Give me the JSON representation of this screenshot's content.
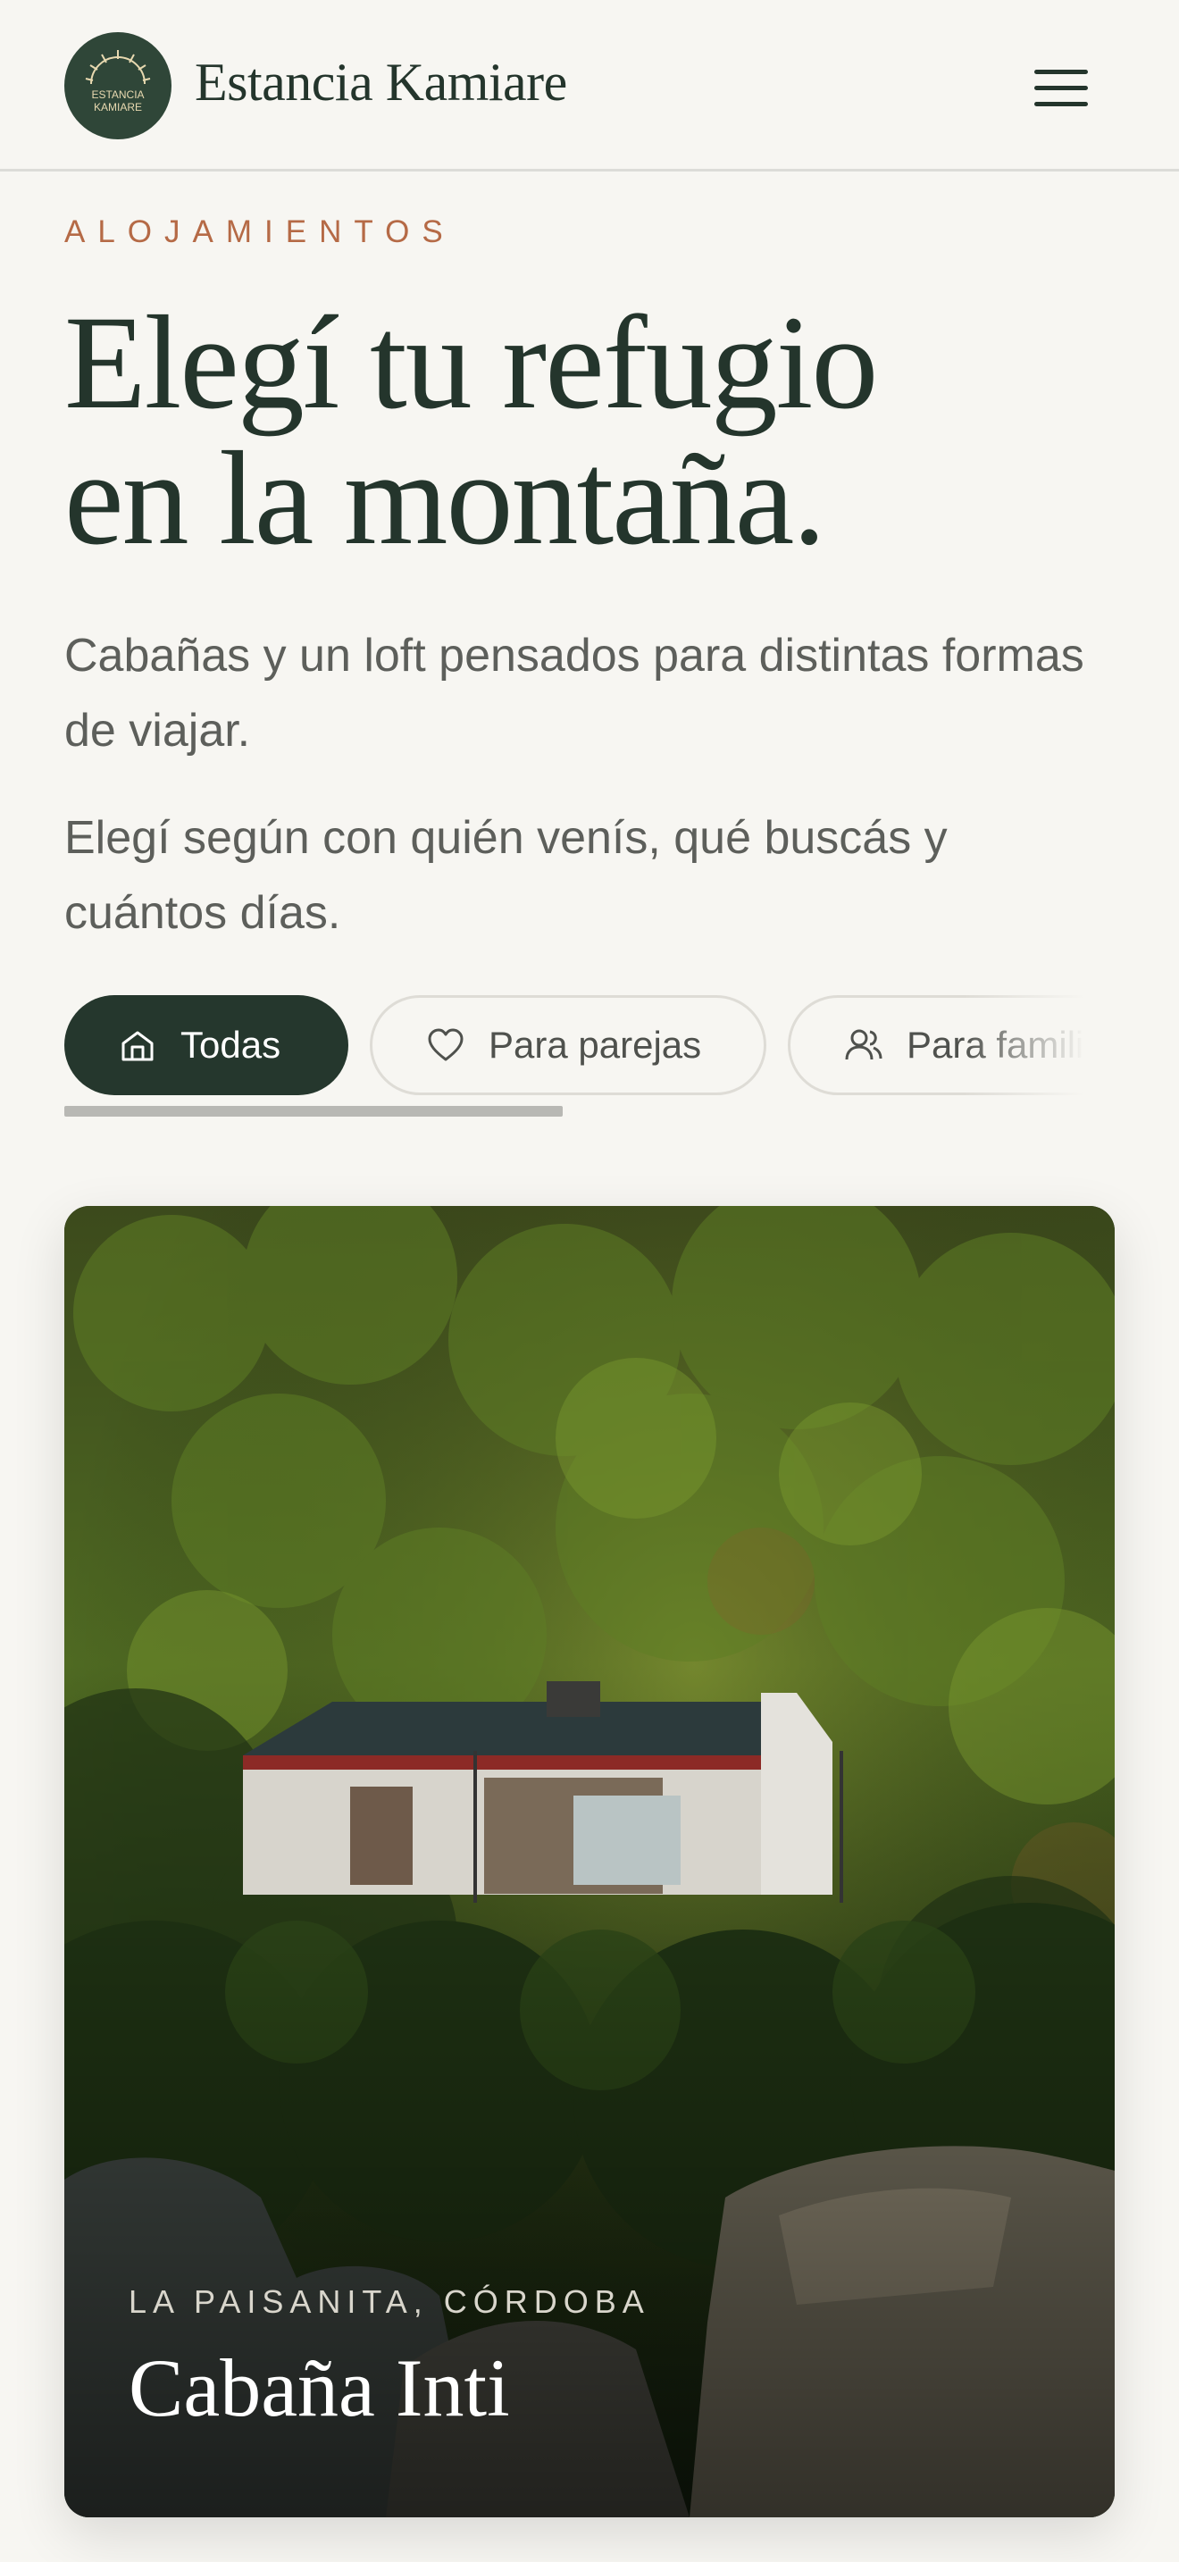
{
  "header": {
    "brand": "Estancia Kamiare",
    "logo_text_line1": "ESTANCIA",
    "logo_text_line2": "KAMIARE",
    "menu_icon": "hamburger-menu-icon"
  },
  "intro": {
    "eyebrow": "ALOJAMIENTOS",
    "headline_line1": "Elegí tu refugio",
    "headline_line2": "en la montaña.",
    "lede1": "Cabañas y un loft pensados para distintas formas de viajar.",
    "lede2": "Elegí según con quién venís, qué buscás y cuántos días."
  },
  "filters": [
    {
      "label": "Todas",
      "icon": "house-icon",
      "active": true
    },
    {
      "label": "Para parejas",
      "icon": "heart-icon",
      "active": false
    },
    {
      "label": "Para familias",
      "icon": "people-icon",
      "active": false
    }
  ],
  "card": {
    "location": "LA PAISANITA, CÓRDOBA",
    "title": "Cabaña Inti"
  },
  "colors": {
    "background": "#f7f6f2",
    "primary": "#25372d",
    "accent": "#b56a46"
  }
}
